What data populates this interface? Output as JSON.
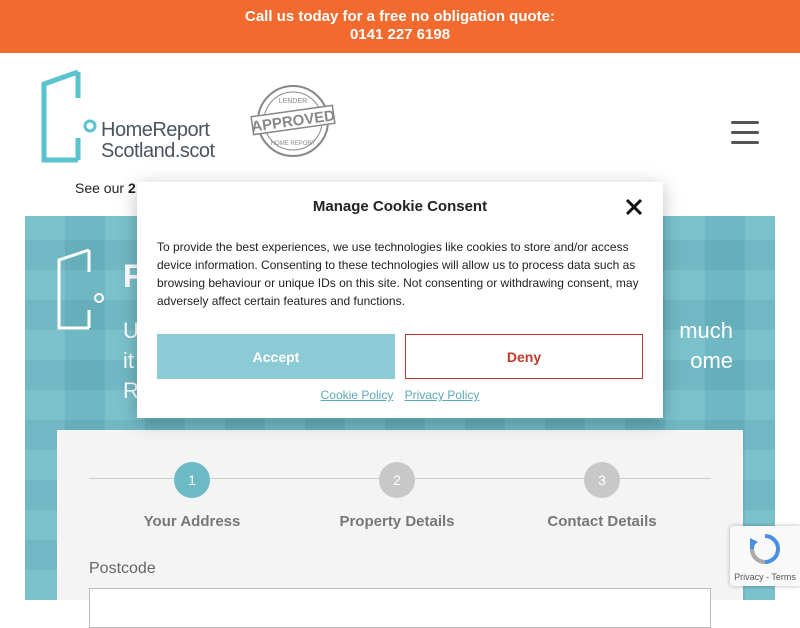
{
  "top_bar": {
    "line1": "Call us today for a free no obligation quote:",
    "line2": "0141 227 6198"
  },
  "header": {
    "logo_line1": "HomeReport",
    "logo_line2": "Scotland.scot",
    "badge_top": "LENDER",
    "badge_main": "APPROVED",
    "badge_bottom": "HOME REPORT",
    "reviews_prefix": "See our",
    "reviews_count": "2"
  },
  "hero": {
    "title": "F",
    "subtitle_line1": "U",
    "subtitle_line1_end": "much",
    "subtitle_line2": "it",
    "subtitle_line2_end": "ome",
    "subtitle_line3": "R"
  },
  "form": {
    "steps": [
      {
        "number": "1",
        "label": "Your Address"
      },
      {
        "number": "2",
        "label": "Property Details"
      },
      {
        "number": "3",
        "label": "Contact Details"
      }
    ],
    "postcode_label": "Postcode"
  },
  "cookie_modal": {
    "title": "Manage Cookie Consent",
    "body": "To provide the best experiences, we use technologies like cookies to store and/or access device information. Consenting to these technologies will allow us to process data such as browsing behaviour or unique IDs on this site. Not consenting or withdrawing consent, may adversely affect certain features and functions.",
    "accept_label": "Accept",
    "deny_label": "Deny",
    "cookie_policy_label": "Cookie Policy",
    "privacy_policy_label": "Privacy Policy"
  },
  "recaptcha": {
    "text": "Privacy - Terms"
  },
  "colors": {
    "top_bar": "#f26a2e",
    "brand_teal": "#6bbac6",
    "accept_button": "#8ccbd5",
    "deny_border": "#c0392b"
  }
}
